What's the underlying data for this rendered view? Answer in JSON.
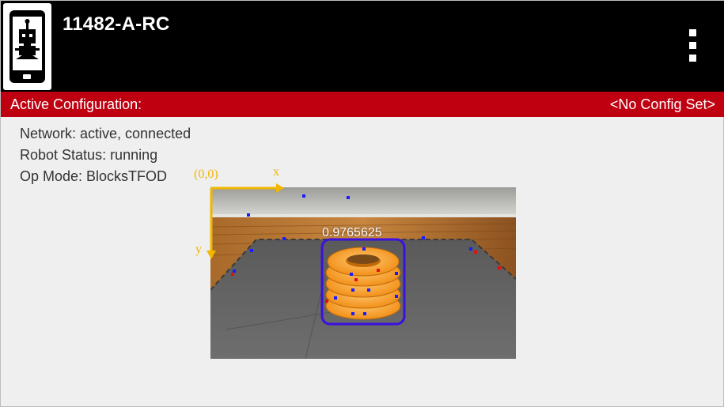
{
  "app": {
    "title": "11482-A-RC"
  },
  "config_bar": {
    "label": "Active Configuration:",
    "value": "<No Config Set>"
  },
  "status": {
    "network": "Network: active, connected",
    "robot": "Robot Status: running",
    "op_mode": "Op Mode: BlocksTFOD"
  },
  "camera": {
    "origin_label": "(0,0)",
    "x_label": "x",
    "y_label": "y",
    "detection_confidence": "0.9765625"
  },
  "colors": {
    "appbar": "#000000",
    "config_bar": "#bf0010",
    "axis": "#f2b600",
    "detection_box": "#3b10e0"
  },
  "icons": {
    "app": "robot-phone-icon",
    "menu": "overflow-menu-icon"
  }
}
